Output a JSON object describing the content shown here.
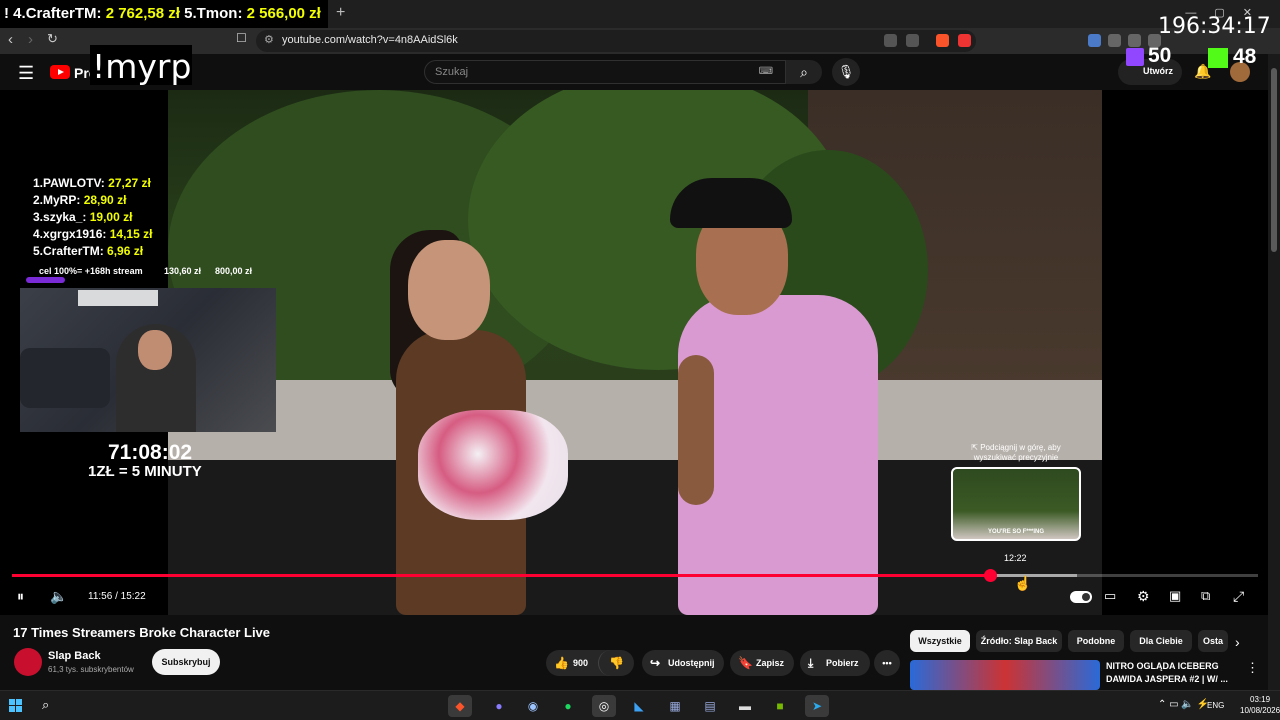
{
  "browser": {
    "url": "youtube.com/watch?v=4n8AAidSl6k",
    "new_tab_icon": "plus-icon"
  },
  "stream_overlay": {
    "donations_ticker": [
      {
        "prefix": "! 4.",
        "name": "CrafterTM:",
        "amount": "2 762,58 zł"
      },
      {
        "prefix": " 5.",
        "name": "Tmon:",
        "amount": "2 566,00 zł"
      }
    ],
    "top_timer": "196:34:17",
    "twitch_viewers": "50",
    "kick_viewers": "48",
    "command": "!myrp",
    "leaderboard": [
      {
        "rank": "1.",
        "name": "PAWLOTV:",
        "amount": "27,27 zł"
      },
      {
        "rank": "2.",
        "name": "MyRP:",
        "amount": "28,90 zł"
      },
      {
        "rank": "3.",
        "name": "szyka_:",
        "amount": "19,00 zł"
      },
      {
        "rank": "4.",
        "name": "xgrgx1916:",
        "amount": "14,15 zł"
      },
      {
        "rank": "5.",
        "name": "CrafterTM:",
        "amount": "6,96 zł"
      }
    ],
    "goal": {
      "label": "cel 100%= +168h stream",
      "current": "130,60 zł",
      "target": "800,00 zł",
      "progress": 0.163
    },
    "subathon_timer": "71:08:02",
    "subathon_rate": "1ZŁ = 5 MINUTY"
  },
  "youtube": {
    "logo_text": "Pre",
    "search_placeholder": "Szukaj",
    "create_label": "Utwórz",
    "player": {
      "current_time": "11:56",
      "duration": "15:22",
      "time_separator": " / ",
      "played_fraction": 0.785,
      "buffered_fraction": 0.855,
      "seek_hint": "⇱ Podciągnij w górę, aby wyszukiwać precyzyjnie",
      "preview_time": "12:22",
      "preview_caption": "YOU'RE SO F***ING"
    },
    "video_title": "17 Times Streamers Broke Character Live",
    "channel": {
      "name": "Slap Back",
      "subscribers": "61,3 tys. subskrybentów"
    },
    "subscribe_label": "Subskrybuj",
    "actions": {
      "likes": "900",
      "share": "Udostępnij",
      "save": "Zapisz",
      "download": "Pobierz"
    },
    "chips": [
      "Wszystkie",
      "Źródło: Slap Back",
      "Podobne",
      "Dla Ciebie",
      "Osta"
    ],
    "recommendation": {
      "title": "NITRO OGLĄDA ICEBERG DAWIDA JASPERA #2 | W/ ..."
    }
  },
  "taskbar": {
    "language": "ENG",
    "time": "03:19",
    "date": "10/08/2026"
  },
  "colors": {
    "accent": "#ff0033",
    "donation_yellow": "#f2ff00",
    "twitch": "#9146ff",
    "kick": "#53fc18"
  }
}
